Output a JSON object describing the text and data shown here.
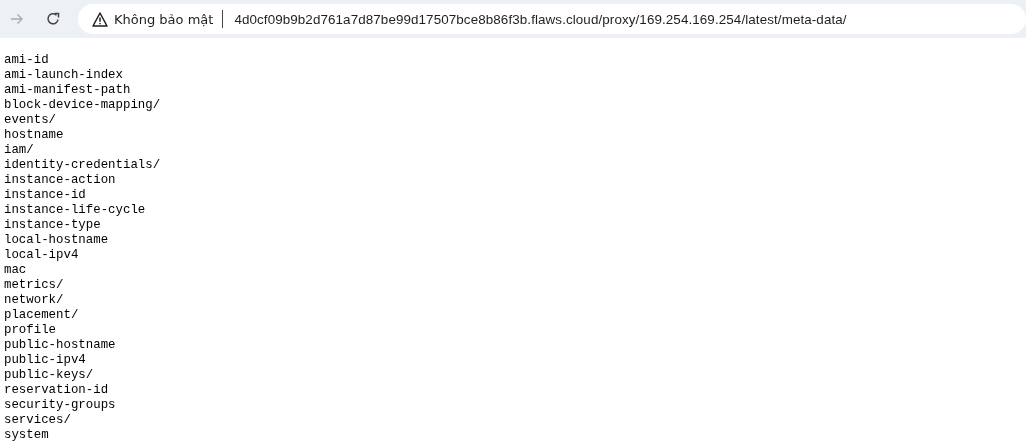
{
  "toolbar": {
    "forward_button": {
      "disabled": true
    },
    "address_bar": {
      "security_label": "Không bảo mật",
      "url": "4d0cf09b9b2d761a7d87be99d17507bce8b86f3b.flaws.cloud/proxy/169.254.169.254/latest/meta-data/"
    }
  },
  "content": {
    "lines": [
      "ami-id",
      "ami-launch-index",
      "ami-manifest-path",
      "block-device-mapping/",
      "events/",
      "hostname",
      "iam/",
      "identity-credentials/",
      "instance-action",
      "instance-id",
      "instance-life-cycle",
      "instance-type",
      "local-hostname",
      "local-ipv4",
      "mac",
      "metrics/",
      "network/",
      "placement/",
      "profile",
      "public-hostname",
      "public-ipv4",
      "public-keys/",
      "reservation-id",
      "security-groups",
      "services/",
      "system"
    ]
  }
}
